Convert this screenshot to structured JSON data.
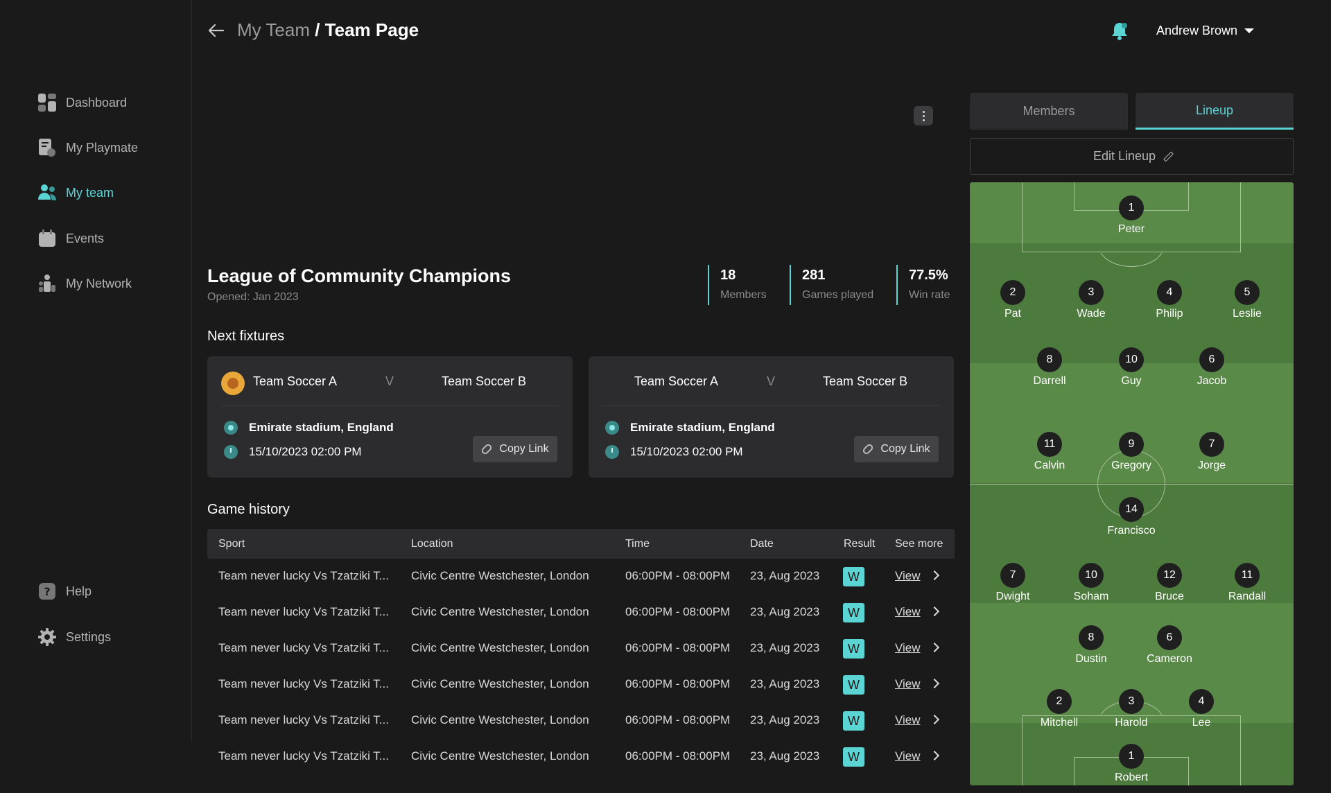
{
  "sidebar": {
    "items": [
      {
        "label": "Dashboard",
        "icon": "dashboard-icon"
      },
      {
        "label": "My Playmate",
        "icon": "playmate-icon"
      },
      {
        "label": "My team",
        "icon": "team-icon",
        "active": true
      },
      {
        "label": "Events",
        "icon": "calendar-icon"
      },
      {
        "label": "My Network",
        "icon": "network-icon"
      }
    ],
    "help": "Help",
    "settings": "Settings"
  },
  "header": {
    "crumb_parent": "My Team",
    "crumb_sep": " / ",
    "crumb_current": "Team Page",
    "user_name": "Andrew Brown"
  },
  "team": {
    "name": "League of Community Champions",
    "opened": "Opened: Jan 2023",
    "stats": [
      {
        "value": "18",
        "label": "Members"
      },
      {
        "value": "281",
        "label": "Games played"
      },
      {
        "value": "77.5%",
        "label": "Win rate"
      }
    ]
  },
  "fixtures": {
    "title": "Next fixtures",
    "items": [
      {
        "team_a": "Team Soccer A",
        "vs": "V",
        "team_b": "Team Soccer B",
        "location": "Emirate stadium, England",
        "datetime": "15/10/2023 02:00 PM",
        "copy_label": "Copy Link",
        "has_logo": true
      },
      {
        "team_a": "Team Soccer A",
        "vs": "V",
        "team_b": "Team Soccer B",
        "location": "Emirate stadium, England",
        "datetime": "15/10/2023 02:00 PM",
        "copy_label": "Copy Link",
        "has_logo": false
      }
    ]
  },
  "history": {
    "title": "Game history",
    "columns": [
      "Sport",
      "Location",
      "Time",
      "Date",
      "Result",
      "See more"
    ],
    "rows": [
      {
        "sport": "Team never lucky Vs Tzatziki T...",
        "location": "Civic Centre Westchester, London",
        "time": "06:00PM - 08:00PM",
        "date": "23, Aug 2023",
        "result": "W",
        "link": "View"
      },
      {
        "sport": "Team never lucky Vs Tzatziki T...",
        "location": "Civic Centre Westchester, London",
        "time": "06:00PM - 08:00PM",
        "date": "23, Aug 2023",
        "result": "W",
        "link": "View"
      },
      {
        "sport": "Team never lucky Vs Tzatziki T...",
        "location": "Civic Centre Westchester, London",
        "time": "06:00PM - 08:00PM",
        "date": "23, Aug 2023",
        "result": "W",
        "link": "View"
      },
      {
        "sport": "Team never lucky Vs Tzatziki T...",
        "location": "Civic Centre Westchester, London",
        "time": "06:00PM - 08:00PM",
        "date": "23, Aug 2023",
        "result": "W",
        "link": "View"
      },
      {
        "sport": "Team never lucky Vs Tzatziki T...",
        "location": "Civic Centre Westchester, London",
        "time": "06:00PM - 08:00PM",
        "date": "23, Aug 2023",
        "result": "W",
        "link": "View"
      },
      {
        "sport": "Team never lucky Vs Tzatziki T...",
        "location": "Civic Centre Westchester, London",
        "time": "06:00PM - 08:00PM",
        "date": "23, Aug 2023",
        "result": "W",
        "link": "View"
      }
    ]
  },
  "panel": {
    "tabs": [
      "Members",
      "Lineup"
    ],
    "active_tab": "Lineup",
    "edit_label": "Edit Lineup"
  },
  "lineup": {
    "top_team": [
      {
        "num": "1",
        "name": "Peter"
      },
      {
        "num": "2",
        "name": "Pat"
      },
      {
        "num": "3",
        "name": "Wade"
      },
      {
        "num": "4",
        "name": "Philip"
      },
      {
        "num": "5",
        "name": "Leslie"
      },
      {
        "num": "8",
        "name": "Darrell"
      },
      {
        "num": "10",
        "name": "Guy"
      },
      {
        "num": "6",
        "name": "Jacob"
      },
      {
        "num": "11",
        "name": "Calvin"
      },
      {
        "num": "9",
        "name": "Gregory"
      },
      {
        "num": "7",
        "name": "Jorge"
      }
    ],
    "bottom_team": [
      {
        "num": "14",
        "name": "Francisco"
      },
      {
        "num": "7",
        "name": "Dwight"
      },
      {
        "num": "10",
        "name": "Soham"
      },
      {
        "num": "12",
        "name": "Bruce"
      },
      {
        "num": "11",
        "name": "Randall"
      },
      {
        "num": "8",
        "name": "Dustin"
      },
      {
        "num": "6",
        "name": "Cameron"
      },
      {
        "num": "2",
        "name": "Mitchell"
      },
      {
        "num": "3",
        "name": "Harold"
      },
      {
        "num": "4",
        "name": "Lee"
      },
      {
        "num": "1",
        "name": "Robert"
      }
    ]
  },
  "colors": {
    "accent": "#5bd4d4",
    "background": "#1a1a1b",
    "card": "#2c2c2e",
    "pitch_light": "#5a8a48",
    "pitch_dark": "#4d7a3d"
  }
}
